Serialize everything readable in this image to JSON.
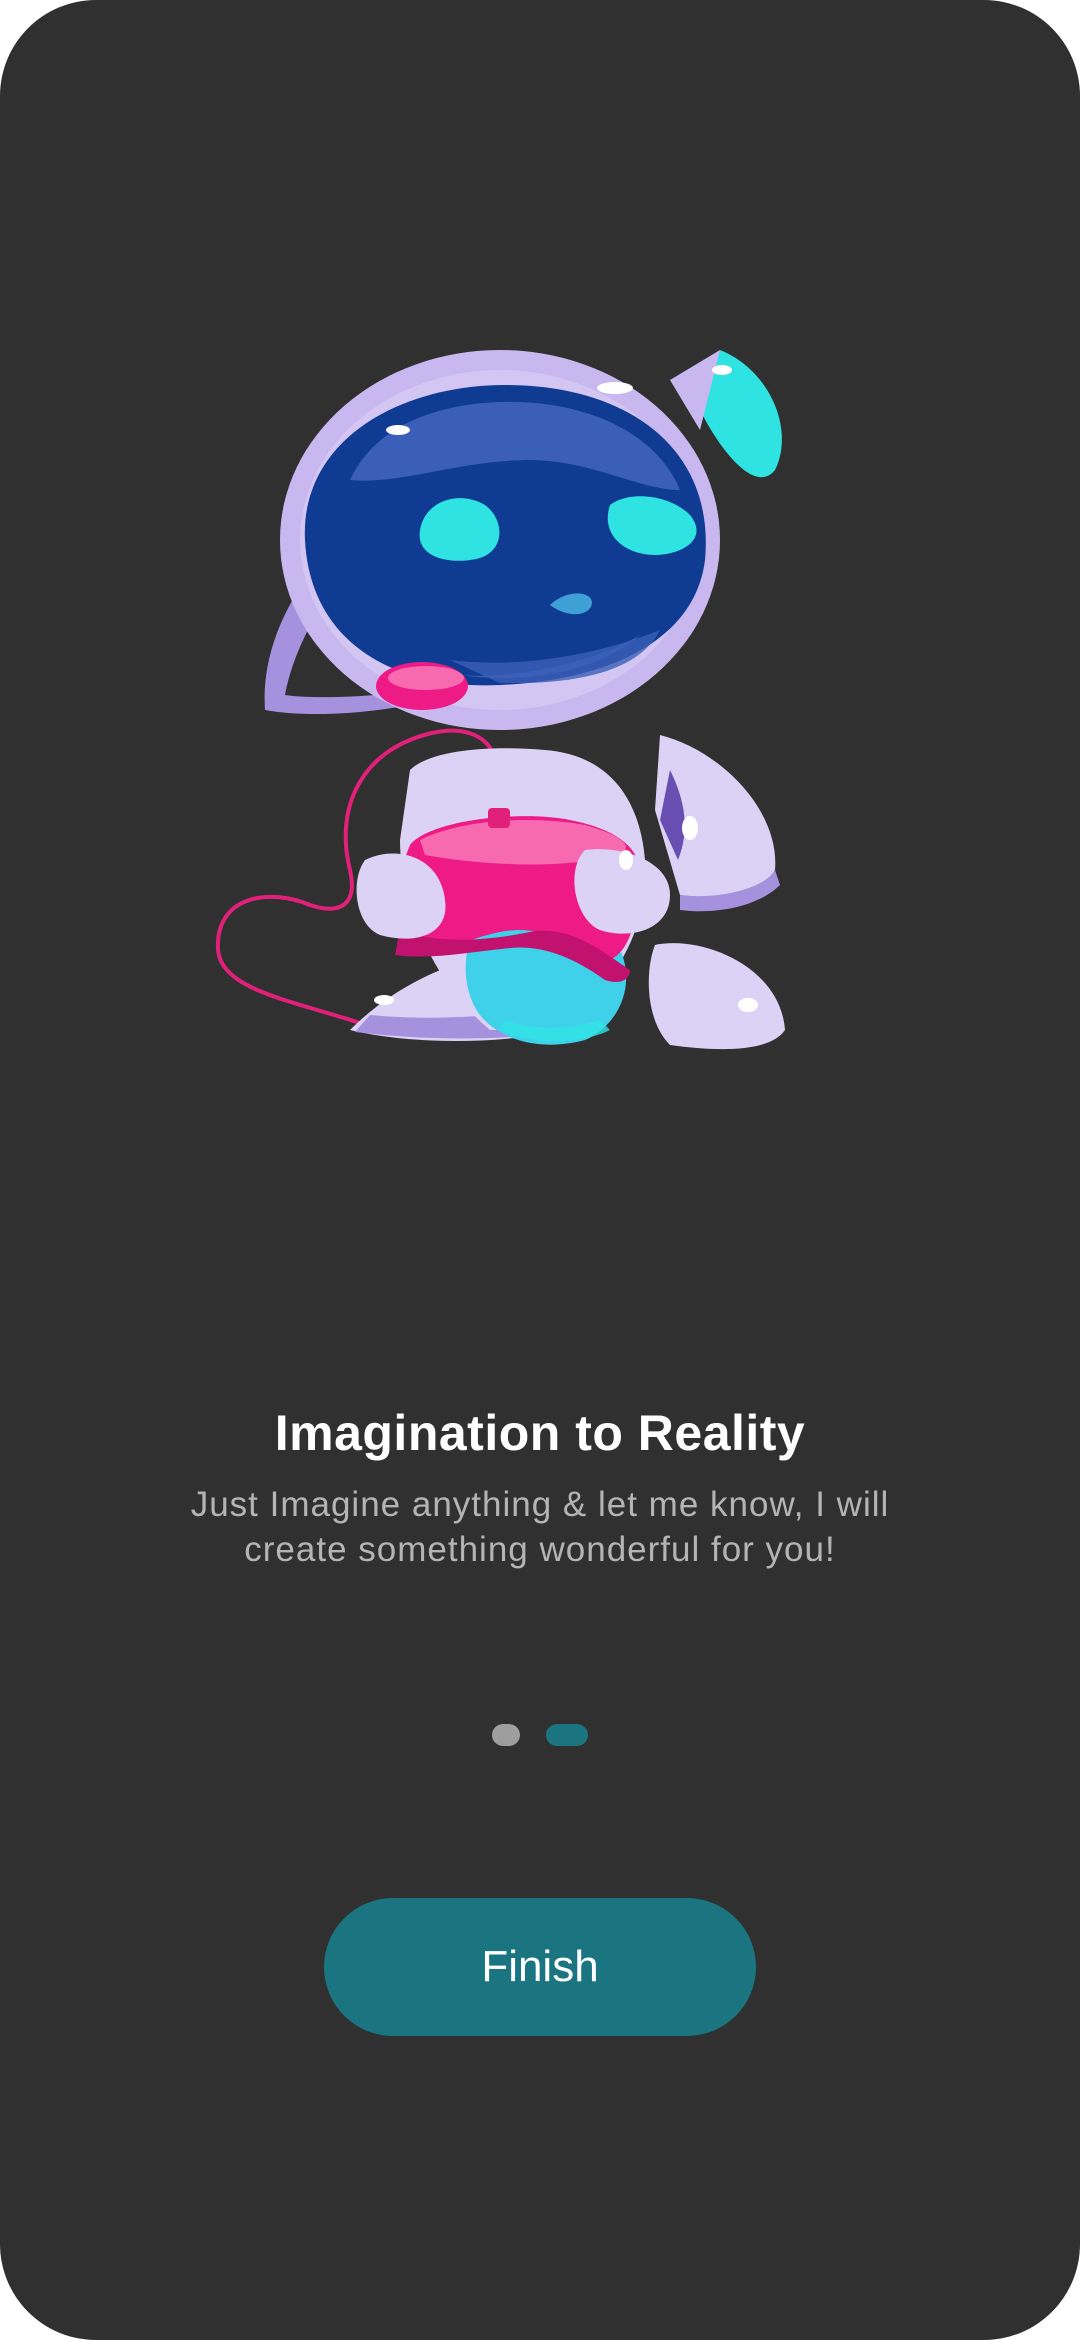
{
  "onboarding": {
    "illustration": "robot-gamer-illustration",
    "title": "Imagination to Reality",
    "subtitle": "Just Imagine anything & let me know, I will create something wonderful for you!",
    "pager": {
      "total_pages": 2,
      "current_page": 2
    },
    "finish_label": "Finish"
  },
  "colors": {
    "background": "#303030",
    "accent": "#1a7580",
    "text_primary": "#ffffff",
    "text_secondary": "#b4b4b4",
    "dot_inactive": "#9e9e9e"
  }
}
